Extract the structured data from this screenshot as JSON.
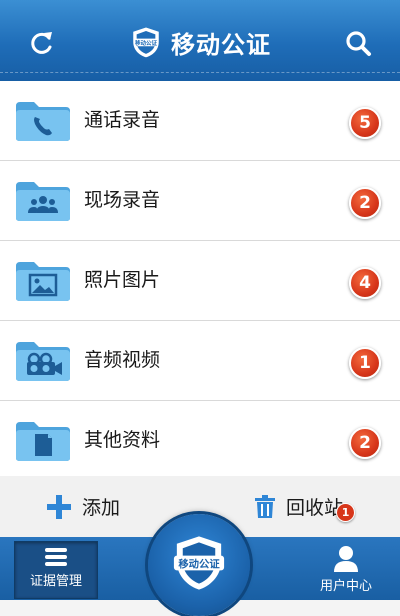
{
  "header": {
    "title": "移动公证",
    "logo_text": "移动公证",
    "refresh_icon": "refresh-icon",
    "search_icon": "search-icon"
  },
  "list": [
    {
      "label": "通话录音",
      "count": "5",
      "icon": "phone-folder-icon"
    },
    {
      "label": "现场录音",
      "count": "2",
      "icon": "people-folder-icon"
    },
    {
      "label": "照片图片",
      "count": "4",
      "icon": "picture-folder-icon"
    },
    {
      "label": "音频视频",
      "count": "1",
      "icon": "camera-folder-icon"
    },
    {
      "label": "其他资料",
      "count": "2",
      "icon": "document-folder-icon"
    }
  ],
  "actions": {
    "add_label": "添加",
    "recycle_label": "回收站",
    "recycle_count": "1"
  },
  "tabbar": {
    "evidence_label": "证据管理",
    "user_label": "用户中心",
    "center_logo_text": "移动公证"
  },
  "colors": {
    "header_blue": "#1f6db8",
    "badge_red": "#d7361a",
    "folder_blue": "#5fb3e8"
  }
}
